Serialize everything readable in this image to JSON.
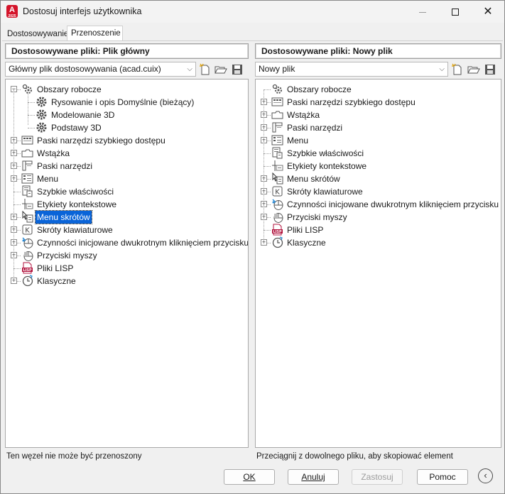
{
  "window": {
    "title": "Dostosuj interfejs użytkownika",
    "app_icon_text": "A",
    "app_icon_subtext": "2025",
    "brand_color": "#d4142a"
  },
  "tabs": [
    {
      "label": "Dostosowywanie",
      "active": false
    },
    {
      "label": "Przenoszenie",
      "active": true
    }
  ],
  "left_panel": {
    "header": "Dostosowywane pliki: Plik główny",
    "file_select": "Główny plik dostosowywania (acad.cuix)",
    "tree": [
      {
        "label": "Obszary robocze",
        "icon": "workspace-gear-icon",
        "expanded": true,
        "level": 0
      },
      {
        "label": "Rysowanie i opis Domyślnie (bieżący)",
        "icon": "gear-icon",
        "level": 1
      },
      {
        "label": "Modelowanie 3D",
        "icon": "gear-icon",
        "level": 1
      },
      {
        "label": "Podstawy 3D",
        "icon": "gear-icon",
        "level": 1
      },
      {
        "label": "Paski narzędzi szybkiego dostępu",
        "icon": "quick-access-toolbar-icon",
        "level": 0,
        "expandable": true
      },
      {
        "label": "Wstążka",
        "icon": "ribbon-icon",
        "level": 0,
        "expandable": true
      },
      {
        "label": "Paski narzędzi",
        "icon": "toolbar-icon",
        "level": 0,
        "expandable": true
      },
      {
        "label": "Menu",
        "icon": "menu-icon",
        "level": 0,
        "expandable": true
      },
      {
        "label": "Szybkie właściwości",
        "icon": "quick-properties-icon",
        "level": 0
      },
      {
        "label": "Etykiety kontekstowe",
        "icon": "rollover-tooltip-icon",
        "level": 0
      },
      {
        "label": "Menu skrótów",
        "icon": "shortcut-menu-icon",
        "level": 0,
        "expandable": true,
        "selected": true
      },
      {
        "label": "Skróty klawiaturowe",
        "icon": "keyboard-shortcut-icon",
        "level": 0,
        "expandable": true
      },
      {
        "label": "Czynności inicjowane dwukrotnym kliknięciem przycisku myszy",
        "icon": "double-click-icon",
        "level": 0,
        "expandable": true
      },
      {
        "label": "Przyciski myszy",
        "icon": "mouse-buttons-icon",
        "level": 0,
        "expandable": true
      },
      {
        "label": "Pliki LISP",
        "icon": "lisp-file-icon",
        "level": 0
      },
      {
        "label": "Klasyczne",
        "icon": "legacy-icon",
        "level": 0,
        "expandable": true
      }
    ],
    "status": "Ten węzeł nie może być przenoszony"
  },
  "right_panel": {
    "header": "Dostosowywane pliki: Nowy plik",
    "file_select": "Nowy plik",
    "tree": [
      {
        "label": "Obszary robocze",
        "icon": "workspace-gear-icon",
        "level": 0
      },
      {
        "label": "Paski narzędzi szybkiego dostępu",
        "icon": "quick-access-toolbar-icon",
        "level": 0,
        "expandable": true
      },
      {
        "label": "Wstążka",
        "icon": "ribbon-icon",
        "level": 0,
        "expandable": true
      },
      {
        "label": "Paski narzędzi",
        "icon": "toolbar-icon",
        "level": 0,
        "expandable": true
      },
      {
        "label": "Menu",
        "icon": "menu-icon",
        "level": 0,
        "expandable": true
      },
      {
        "label": "Szybkie właściwości",
        "icon": "quick-properties-icon",
        "level": 0
      },
      {
        "label": "Etykiety kontekstowe",
        "icon": "rollover-tooltip-icon",
        "level": 0
      },
      {
        "label": "Menu skrótów",
        "icon": "shortcut-menu-icon",
        "level": 0,
        "expandable": true
      },
      {
        "label": "Skróty klawiaturowe",
        "icon": "keyboard-shortcut-icon",
        "level": 0,
        "expandable": true
      },
      {
        "label": "Czynności inicjowane dwukrotnym kliknięciem przycisku myszy",
        "icon": "double-click-icon",
        "level": 0,
        "expandable": true
      },
      {
        "label": "Przyciski myszy",
        "icon": "mouse-buttons-icon",
        "level": 0,
        "expandable": true
      },
      {
        "label": "Pliki LISP",
        "icon": "lisp-file-icon",
        "level": 0
      },
      {
        "label": "Klasyczne",
        "icon": "legacy-icon",
        "level": 0,
        "expandable": true
      }
    ],
    "status": "Przeciągnij z dowolnego pliku, aby skopiować element"
  },
  "buttons": {
    "ok": "OK",
    "cancel": "Anuluj",
    "apply": "Zastosuj",
    "help": "Pomoc"
  },
  "colors": {
    "selection": "#0a64d8",
    "lisp": "#b0123c"
  }
}
